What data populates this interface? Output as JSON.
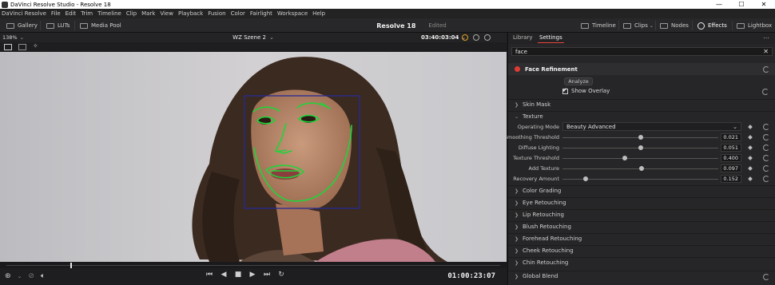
{
  "window": {
    "title": "DaVinci Resolve Studio - Resolve 18"
  },
  "menu": [
    "DaVinci Resolve",
    "File",
    "Edit",
    "Trim",
    "Timeline",
    "Clip",
    "Mark",
    "View",
    "Playback",
    "Fusion",
    "Color",
    "Fairlight",
    "Workspace",
    "Help"
  ],
  "toolbar": {
    "gallery": "Gallery",
    "luts": "LUTs",
    "media_pool": "Media Pool",
    "project_name": "Resolve 18",
    "project_state": "Edited",
    "timeline": "Timeline",
    "clips": "Clips",
    "nodes": "Nodes",
    "effects": "Effects",
    "lightbox": "Lightbox"
  },
  "viewer": {
    "zoom": "138%",
    "clip_name": "WZ Szene 2",
    "timecode_top": "03:40:03:04",
    "timecode_bottom": "01:00:23:07"
  },
  "inspector": {
    "tabs": [
      "Library",
      "Settings"
    ],
    "active_tab": "Settings",
    "search_value": "face",
    "effect_name": "Face Refinement",
    "analyze_label": "Analyze",
    "show_overlay_label": "Show Overlay",
    "show_overlay_checked": true,
    "sections_top": [
      "Skin Mask",
      "Texture"
    ],
    "operating_mode_label": "Operating Mode",
    "operating_mode_value": "Beauty Advanced",
    "params": [
      {
        "label": "Smoothing Threshold",
        "value": "0.021",
        "fraction": 0.5
      },
      {
        "label": "Diffuse Lighting",
        "value": "0.051",
        "fraction": 0.5
      },
      {
        "label": "Texture Threshold",
        "value": "0.400",
        "fraction": 0.4
      },
      {
        "label": "Add Texture",
        "value": "0.097",
        "fraction": 0.51
      },
      {
        "label": "Recovery Amount",
        "value": "0.152",
        "fraction": 0.15
      }
    ],
    "sections_bottom": [
      "Color Grading",
      "Eye Retouching",
      "Lip Retouching",
      "Blush Retouching",
      "Forehead Retouching",
      "Cheek Retouching",
      "Chin Retouching",
      "Global Blend"
    ]
  },
  "colors": {
    "accent": "#e8433a",
    "overlay_face": "#21c33a",
    "overlay_box": "#2a2fa0"
  }
}
